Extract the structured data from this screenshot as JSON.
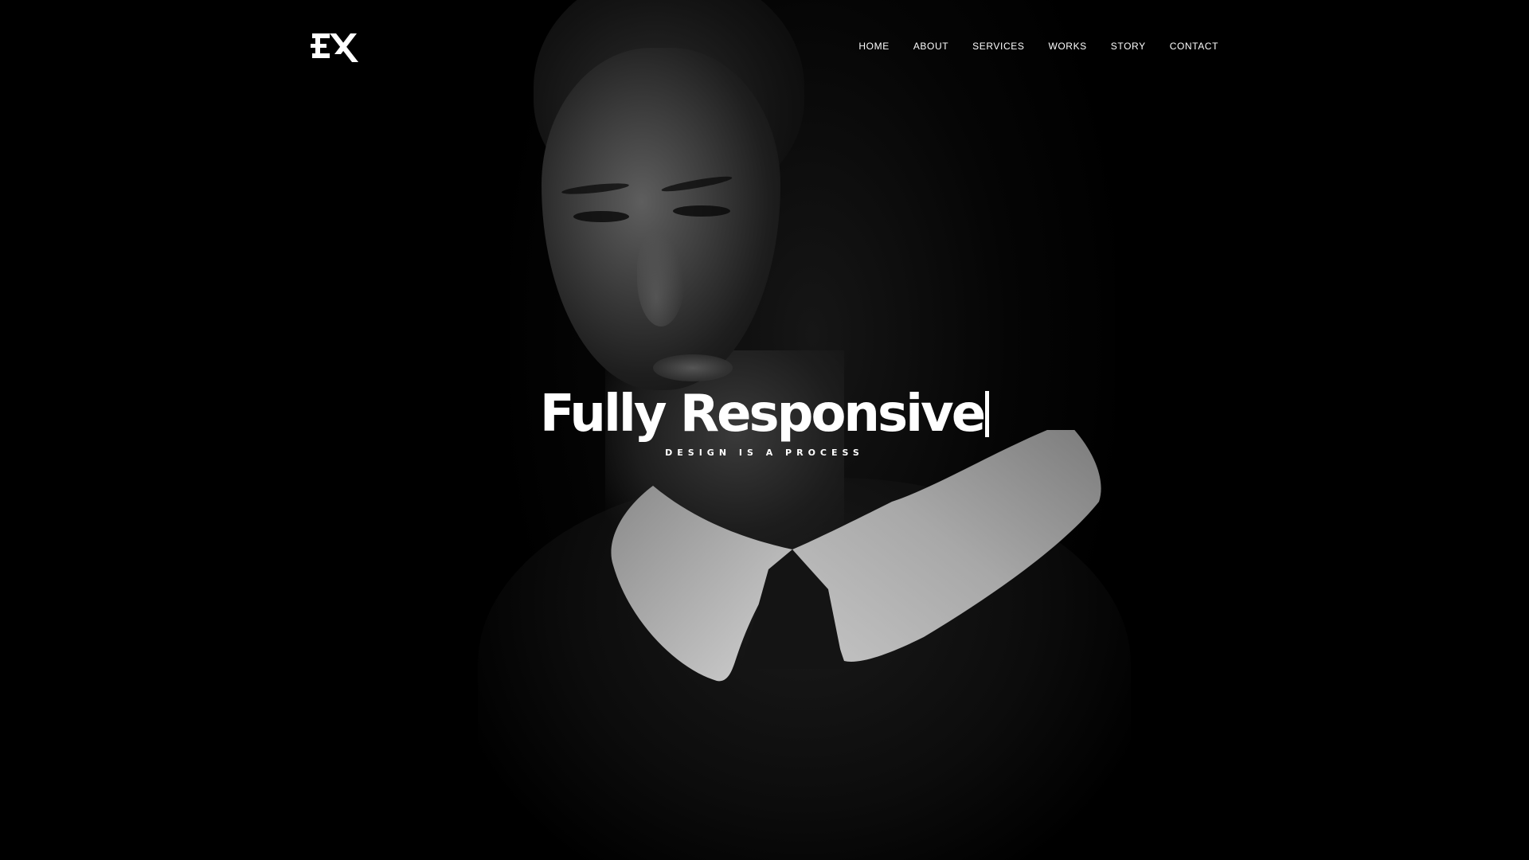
{
  "brand": {
    "logo_text": "EX"
  },
  "nav": {
    "items": [
      {
        "label": "HOME"
      },
      {
        "label": "ABOUT"
      },
      {
        "label": "SERVICES"
      },
      {
        "label": "WORKS"
      },
      {
        "label": "STORY"
      },
      {
        "label": "CONTACT"
      }
    ]
  },
  "hero": {
    "title": "Fully Responsive",
    "subtitle": "DESIGN IS A PROCESS",
    "background_image": "black-and-white-portrait-of-woman-with-white-collar"
  },
  "colors": {
    "background": "#000000",
    "text": "#ffffff"
  }
}
